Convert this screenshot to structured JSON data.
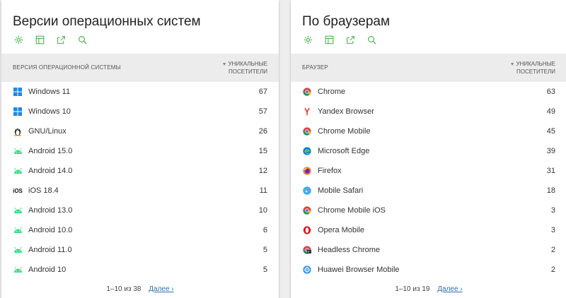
{
  "os_card": {
    "title": "Версии операционных систем",
    "column_name": "Версия операционной системы",
    "column_metric_line1": "Уникальные",
    "column_metric_line2": "посетители",
    "rows": [
      {
        "label": "Windows 11",
        "value": "67",
        "icon": "windows-icon"
      },
      {
        "label": "Windows 10",
        "value": "57",
        "icon": "windows-icon"
      },
      {
        "label": "GNU/Linux",
        "value": "26",
        "icon": "linux-icon"
      },
      {
        "label": "Android 15.0",
        "value": "15",
        "icon": "android-icon"
      },
      {
        "label": "Android 14.0",
        "value": "12",
        "icon": "android-icon"
      },
      {
        "label": "iOS 18.4",
        "value": "11",
        "icon": "ios-icon"
      },
      {
        "label": "Android 13.0",
        "value": "10",
        "icon": "android-icon"
      },
      {
        "label": "Android 10.0",
        "value": "6",
        "icon": "android-icon"
      },
      {
        "label": "Android 11.0",
        "value": "5",
        "icon": "android-icon"
      },
      {
        "label": "Android 10",
        "value": "5",
        "icon": "android-icon"
      }
    ],
    "pager_range": "1–10 из 38",
    "pager_next": "Далее ›"
  },
  "browser_card": {
    "title": "По браузерам",
    "column_name": "Браузер",
    "column_metric_line1": "Уникальные",
    "column_metric_line2": "посетители",
    "rows": [
      {
        "label": "Chrome",
        "value": "63",
        "icon": "chrome-icon"
      },
      {
        "label": "Yandex Browser",
        "value": "49",
        "icon": "yandex-icon"
      },
      {
        "label": "Chrome Mobile",
        "value": "45",
        "icon": "chrome-icon"
      },
      {
        "label": "Microsoft Edge",
        "value": "39",
        "icon": "edge-icon"
      },
      {
        "label": "Firefox",
        "value": "31",
        "icon": "firefox-icon"
      },
      {
        "label": "Mobile Safari",
        "value": "18",
        "icon": "safari-icon"
      },
      {
        "label": "Chrome Mobile iOS",
        "value": "3",
        "icon": "chrome-icon"
      },
      {
        "label": "Opera Mobile",
        "value": "3",
        "icon": "opera-icon"
      },
      {
        "label": "Headless Chrome",
        "value": "2",
        "icon": "headless-chrome-icon"
      },
      {
        "label": "Huawei Browser Mobile",
        "value": "2",
        "icon": "huawei-browser-icon"
      }
    ],
    "pager_range": "1–10 из 19",
    "pager_next": "Далее ›"
  },
  "colors": {
    "accent_green": "#4caf50",
    "link_blue": "#2a6fb5",
    "header_bg": "#ececec"
  }
}
